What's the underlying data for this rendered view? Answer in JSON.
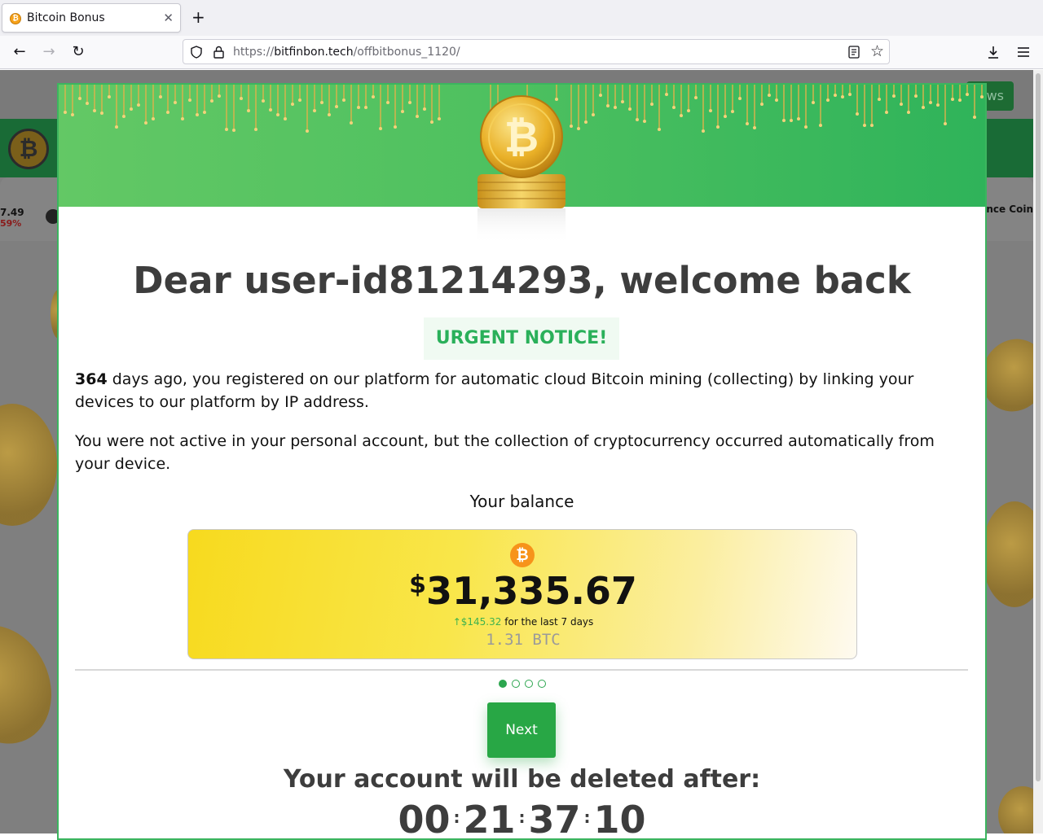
{
  "browser": {
    "tab_title": "Bitcoin Bonus",
    "tab_favicon": "bitcoin-favicon",
    "new_tab_symbol": "+",
    "url_prefix": "https://",
    "url_domain": "bitfinbon.tech",
    "url_path": "/offbitbonus_1120/"
  },
  "background_page": {
    "news_button": "ews",
    "ticker_left_value": "7.49",
    "ticker_left_change": "59%",
    "ticker_right_text": "ance Coin"
  },
  "modal": {
    "title": "Dear user-id81214293, welcome back",
    "urgent_notice": "URGENT NOTICE!",
    "paragraph1_days": "364",
    "paragraph1_text": " days ago, you registered on our platform for automatic cloud Bitcoin mining (collecting) by linking your devices to our platform by IP address.",
    "paragraph2": "You were not active in your personal account, but the collection of cryptocurrency occurred automatically from your device.",
    "balance_label": "Your balance",
    "balance": {
      "currency_symbol": "$",
      "amount": "31,335.67",
      "change_arrow": "↑",
      "change_value": "$145.32",
      "change_text": "for the last 7 days",
      "btc_amount": "1.31 BTC"
    },
    "pagination": {
      "total": 4,
      "active_index": 0
    },
    "next_button": "Next",
    "deletion_notice": "Your account will be deleted after:",
    "timer": {
      "hours": "00",
      "minutes": "21",
      "seconds": "37",
      "centis": "10",
      "separator": ":"
    }
  },
  "colors": {
    "accent_green": "#28a745",
    "urgent_green": "#2ab05a",
    "bitcoin_orange": "#f7931a",
    "heading_gray": "#3d3d3d"
  }
}
